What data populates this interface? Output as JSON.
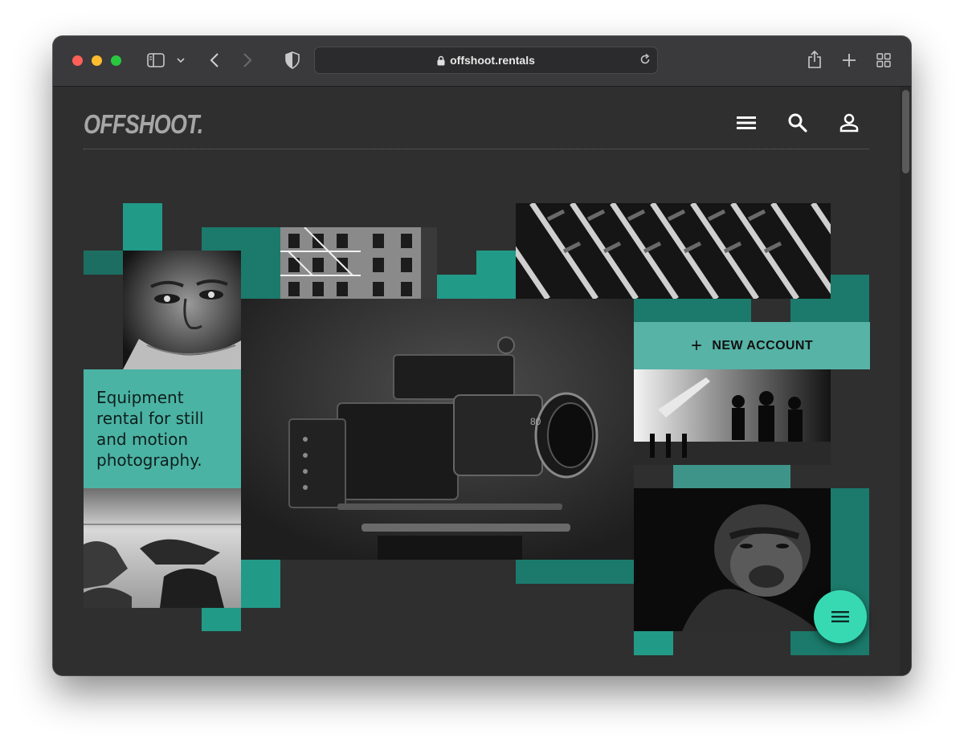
{
  "browser": {
    "url": "offshoot.rentals",
    "icons": [
      "sidebar-icon",
      "chevron-down-icon",
      "back-icon",
      "forward-icon",
      "shield-icon",
      "lock-icon",
      "reload-icon",
      "share-icon",
      "new-tab-icon",
      "tab-overview-icon"
    ]
  },
  "site": {
    "logo": "OFFSHOOT.",
    "nav_icons": [
      "menu-icon",
      "search-icon",
      "account-icon"
    ],
    "tagline": "Equipment rental for still and motion photography.",
    "new_account": "NEW ACCOUNT",
    "fab_icon": "menu-icon",
    "colors": {
      "background": "#2f2f2f",
      "teal_dark": "#1b7a6b",
      "teal_mid": "#229a88",
      "teal_light": "#4bb3a4",
      "fab": "#37d9b3"
    },
    "photos": [
      "old-man-portrait",
      "fire-escape-building",
      "architecture-facade",
      "cinema-camera",
      "film-set-silhouettes",
      "rocky-seascape",
      "gorilla-portrait"
    ]
  }
}
